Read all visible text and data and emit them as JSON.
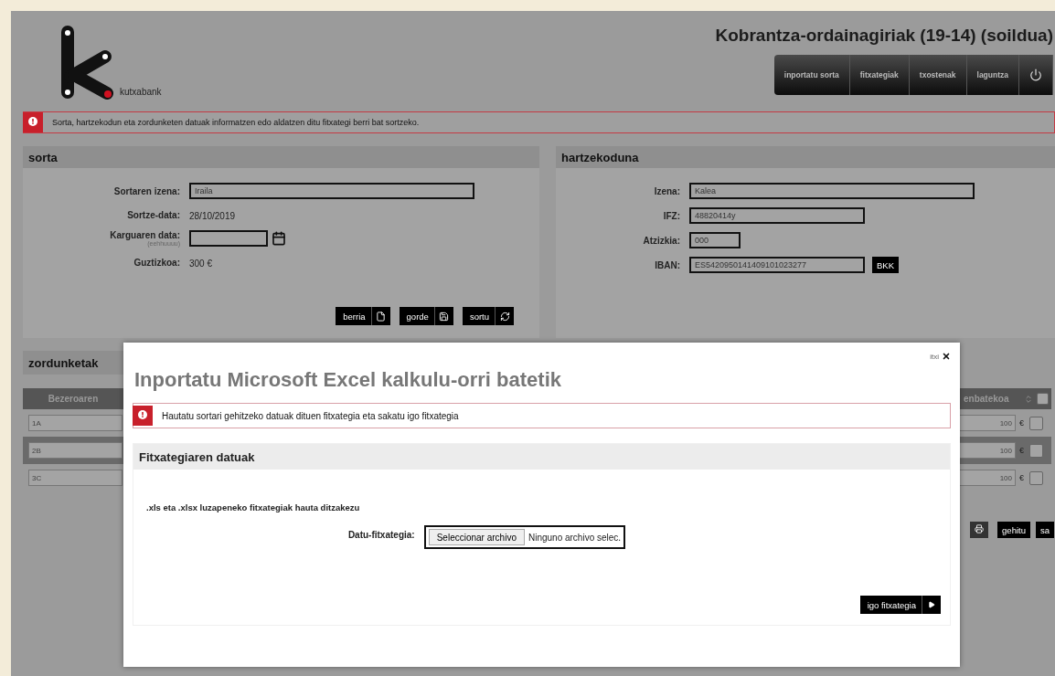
{
  "header": {
    "logo_text": "kutxabank",
    "title": "Kobrantza-ordainagiriak (19-14) (soildua)",
    "nav": [
      {
        "kind": "text",
        "label": "inportatu sorta"
      },
      {
        "kind": "text",
        "label": "fitxategiak"
      },
      {
        "kind": "text",
        "label": "txostenak"
      },
      {
        "kind": "text",
        "label": "laguntza"
      },
      {
        "kind": "power"
      }
    ]
  },
  "alert": "Sorta, hartzekodun eta zordunketen datuak informatzen edo aldatzen ditu fitxategi berri bat sortzeko.",
  "sorta": {
    "title": "sorta",
    "fields": [
      {
        "kind": "input",
        "label": "Sortaren izena:",
        "value": "Iraila"
      },
      {
        "kind": "text",
        "label": "Sortze-data:",
        "value": "28/10/2019"
      },
      {
        "kind": "date",
        "label": "Karguaren data:",
        "hint": "(eehhuuuu)"
      },
      {
        "kind": "text",
        "label": "Guztizkoa:",
        "value": "300 €"
      }
    ],
    "buttons": [
      {
        "kind": "new",
        "label": "berria"
      },
      {
        "kind": "save",
        "label": "gorde"
      },
      {
        "kind": "generate",
        "label": "sortu"
      }
    ]
  },
  "hartzekoduna": {
    "title": "hartzekoduna",
    "fields": [
      {
        "kind": "name",
        "label": "Izena:",
        "value": "Kalea"
      },
      {
        "kind": "id",
        "label": "IFZ:",
        "value": "48820414y"
      },
      {
        "kind": "suffix",
        "label": "Atzizkia:",
        "value": "000"
      },
      {
        "kind": "iban",
        "label": "IBAN:",
        "value": "ES5420950141409101023277",
        "button": "BKK"
      }
    ]
  },
  "zordunketak": {
    "title": "zordunketak",
    "columns": [
      "Bezeroaren",
      "enbatekoa"
    ],
    "select_all": {
      "checked": false
    },
    "rows": [
      {
        "client": "1A",
        "amount": "100",
        "currency": "€",
        "checked": false,
        "selected": false
      },
      {
        "client": "2B",
        "amount": "100",
        "currency": "€",
        "checked": false,
        "selected": true
      },
      {
        "client": "3C",
        "amount": "100",
        "currency": "€",
        "checked": false,
        "selected": false
      }
    ],
    "buttons": [
      {
        "kind": "icon"
      },
      {
        "kind": "text",
        "label": "gehitu"
      },
      {
        "kind": "text",
        "label": "sa"
      }
    ]
  },
  "modal": {
    "close_label": "itxi",
    "title": "Inportatu Microsoft Excel kalkulu-orri batetik",
    "alert": "Hautatu sortari gehitzeko datuak dituen fitxategia eta sakatu igo fitxategia",
    "section_title": "Fitxategiaren datuak",
    "note": ".xls eta .xlsx luzapeneko fitxategiak hauta ditzakezu",
    "file_label": "Datu-fitxategia:",
    "file_button": "Seleccionar archivo",
    "file_status": "Ninguno archivo selec.",
    "submit": "igo fitxategia"
  }
}
